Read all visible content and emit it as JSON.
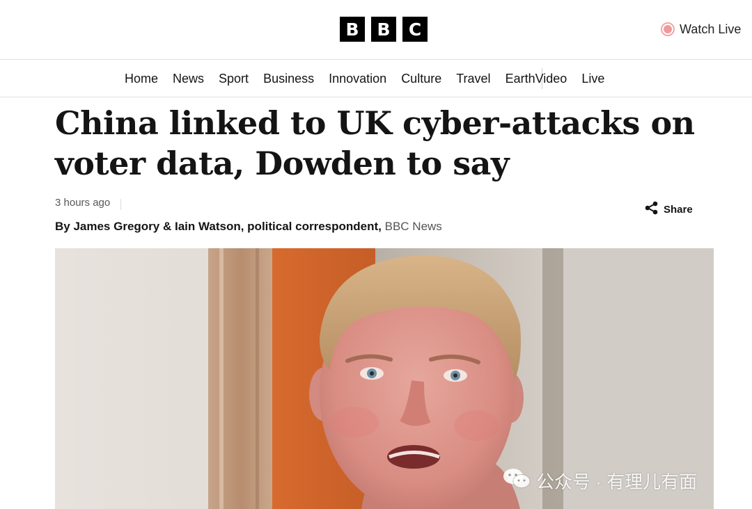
{
  "masthead": {
    "logo_letters": [
      "B",
      "B",
      "C"
    ],
    "watch_live": {
      "label": "Watch Live",
      "icon": "live-dot-icon",
      "color": "#ef9a9a"
    }
  },
  "nav": {
    "items": [
      {
        "label": "Home"
      },
      {
        "label": "News"
      },
      {
        "label": "Sport"
      },
      {
        "label": "Business"
      },
      {
        "label": "Innovation"
      },
      {
        "label": "Culture"
      },
      {
        "label": "Travel"
      },
      {
        "label": "Earth"
      },
      {
        "label": "Video"
      },
      {
        "label": "Live"
      }
    ]
  },
  "article": {
    "headline": "China linked to UK cyber-attacks on voter data, Dowden to say",
    "timestamp": "3 hours ago",
    "byline_author": "By James Gregory & Iain Watson, political correspondent,",
    "byline_source": "BBC News",
    "share_label": "Share",
    "share_icon": "share-icon"
  },
  "hero": {
    "watermark": "公众号 · 有理儿有面",
    "watermark_icon": "wechat-icon"
  },
  "colors": {
    "text": "#141414",
    "muted": "#545658",
    "divider": "#e0e0e0",
    "live_accent": "#ef9a9a"
  }
}
